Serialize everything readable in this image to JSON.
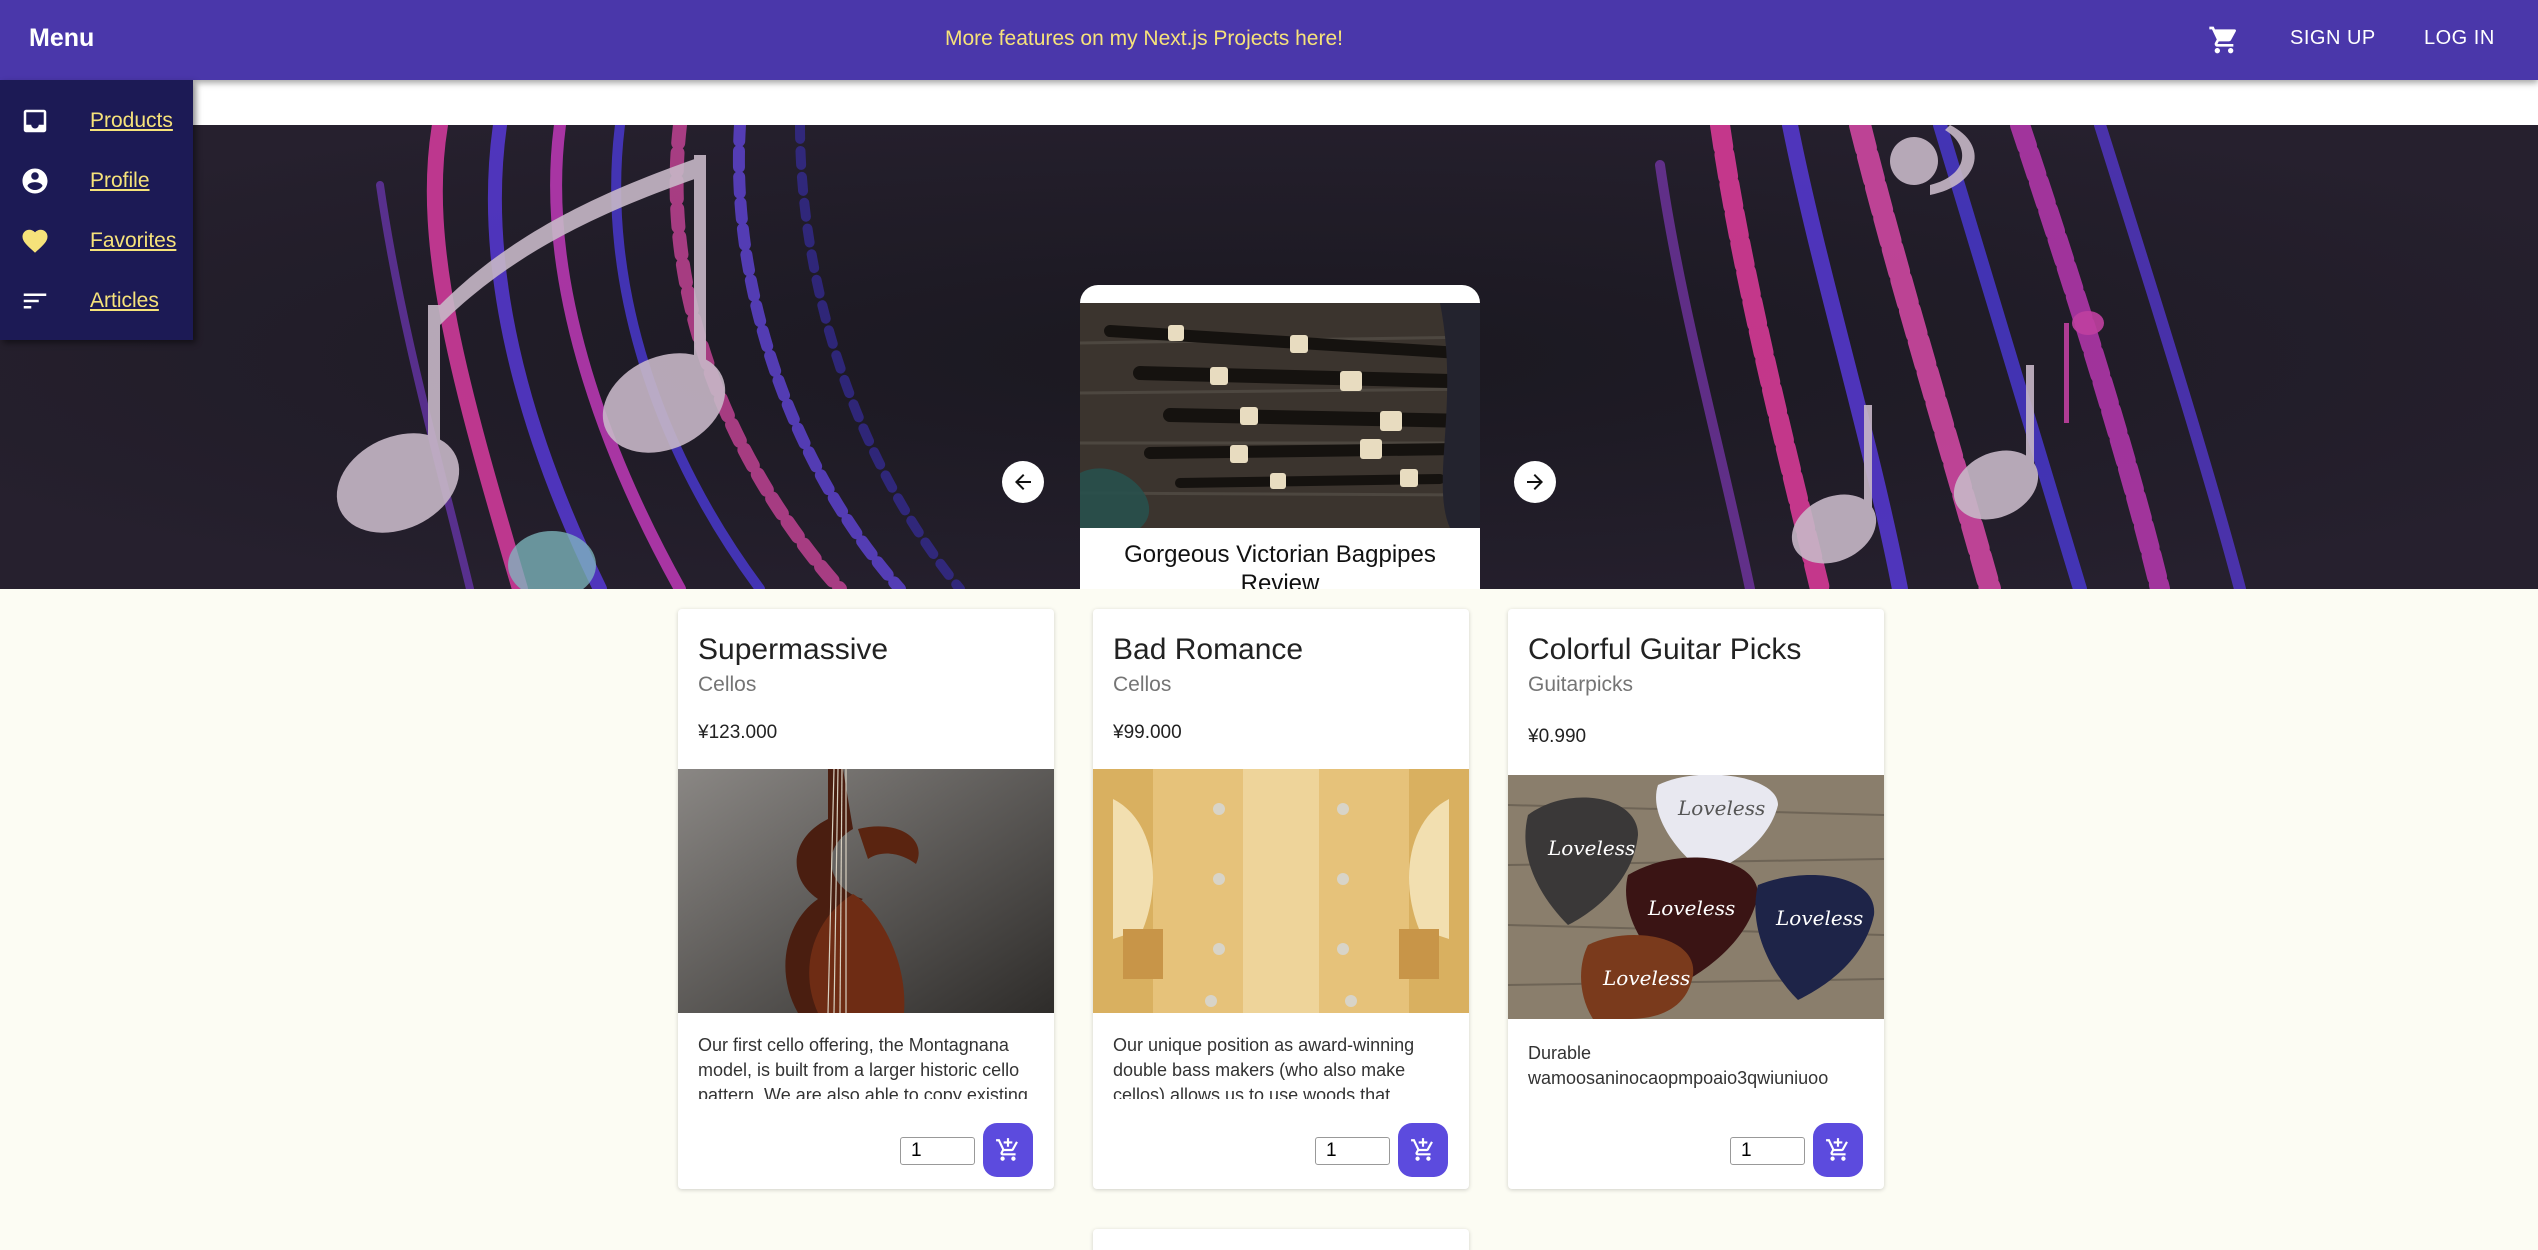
{
  "appbar": {
    "menu_title": "Menu",
    "promo": "More features on my Next.js Projects here!",
    "cart_icon": "shopping-cart-icon",
    "signup_label": "SIGN UP",
    "login_label": "LOG IN"
  },
  "drawer": {
    "items": [
      {
        "label": "Products",
        "icon": "inbox-icon"
      },
      {
        "label": "Profile",
        "icon": "account-circle-icon"
      },
      {
        "label": "Favorites",
        "icon": "heart-icon"
      },
      {
        "label": "Articles",
        "icon": "sort-lines-icon"
      }
    ]
  },
  "carousel": {
    "caption": "Gorgeous Victorian Bagpipes Review",
    "dot_count": 5,
    "active_dot": 1,
    "active_color": "#f6e27a"
  },
  "products": [
    {
      "title": "Supermassive",
      "category": "Cellos",
      "price": "¥123.000",
      "description": "Our first cello offering, the Montagnana model, is built from a larger historic cello pattern. We are also able to copy existing cellos and make them to fit your needs",
      "quantity": "1"
    },
    {
      "title": "Bad Romance",
      "category": "Cellos",
      "price": "¥99.000",
      "description": "Our unique position as award-winning double bass makers (who also make cellos) allows us to use woods that traditional luthiers cannot, for a deeper sound",
      "quantity": "1"
    },
    {
      "title": "Colorful Guitar Picks",
      "category": "Guitarpicks",
      "price": "¥0.990",
      "description": "Durable wamoosaninocaopmpoaio3qwiuniuoo",
      "quantity": "1"
    }
  ],
  "colors": {
    "appbar": "#4a37aa",
    "accent_yellow": "#f6e27a",
    "drawer": "#1c1a55",
    "add_button": "#5c4bde"
  }
}
